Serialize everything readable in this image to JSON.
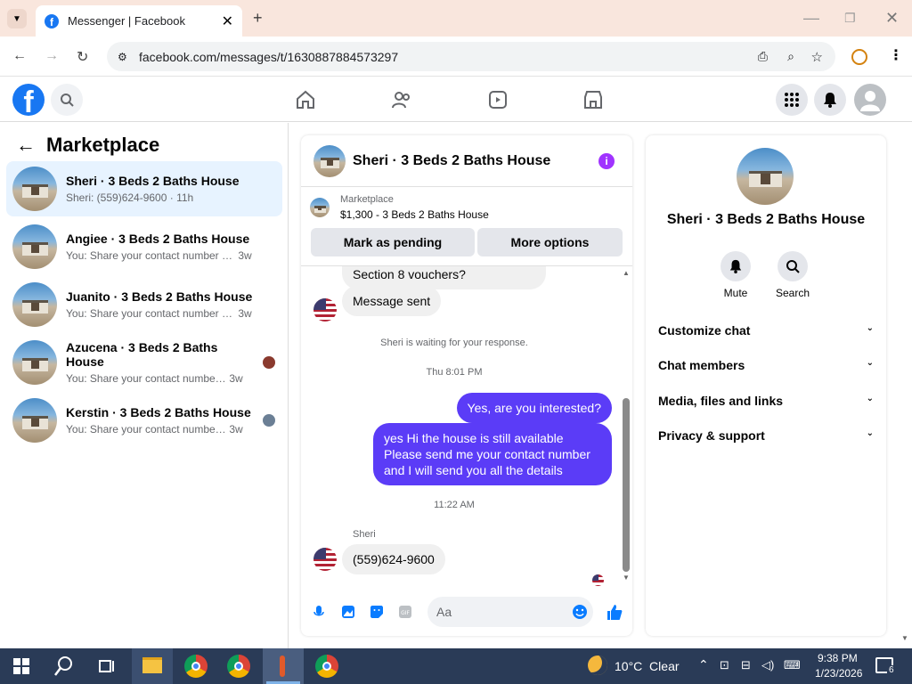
{
  "browser": {
    "tab_title": "Messenger | Facebook",
    "url": "facebook.com/messages/t/1630887884573297"
  },
  "left": {
    "title": "Marketplace",
    "conversations": [
      {
        "name": "Sheri · 3 Beds 2 Baths House",
        "preview": "Sheri: (559)624-9600",
        "time": "· 11h",
        "selected": true
      },
      {
        "name": "Angiee · 3 Beds 2 Baths House",
        "preview": "You: Share your contact number and i...",
        "time": "3w"
      },
      {
        "name": "Juanito · 3 Beds 2 Baths House",
        "preview": "You: Share your contact number and i...",
        "time": "3w"
      },
      {
        "name": "Azucena · 3 Beds 2 Baths House",
        "preview": "You: Share your contact number a...",
        "time": "3w"
      },
      {
        "name": "Kerstin · 3 Beds 2 Baths House",
        "preview": "You: Share your contact number a...",
        "time": "3w"
      }
    ]
  },
  "chat": {
    "title": "Sheri · 3 Beds 2 Baths House",
    "listing_label": "Marketplace",
    "listing": "$1,300 - 3 Beds 2 Baths House",
    "mark_pending": "Mark as pending",
    "more_options": "More options",
    "messages": {
      "m1": "Section 8 vouchers?",
      "m2": "Message sent",
      "waiting": "Sheri is waiting for your response.",
      "time1": "Thu 8:01 PM",
      "out1": "Yes, are you interested?",
      "out2": "yes Hi the house is still available Please send me your contact number and I will send you all the details",
      "time2": "11:22 AM",
      "sender": "Sheri",
      "m3": "(559)624-9600"
    },
    "composer_placeholder": "Aa"
  },
  "right": {
    "name": "Sheri · 3 Beds 2 Baths House",
    "mute": "Mute",
    "search": "Search",
    "sections": [
      "Customize chat",
      "Chat members",
      "Media, files and links",
      "Privacy & support"
    ]
  },
  "taskbar": {
    "weather": "10°C  Clear",
    "time": "9:38 PM",
    "date": "1/23/2026",
    "notif": "6"
  },
  "colors": {
    "fb_blue": "#1877f2",
    "bubble_out": "#5b3cf7",
    "selected": "#e7f3ff"
  }
}
